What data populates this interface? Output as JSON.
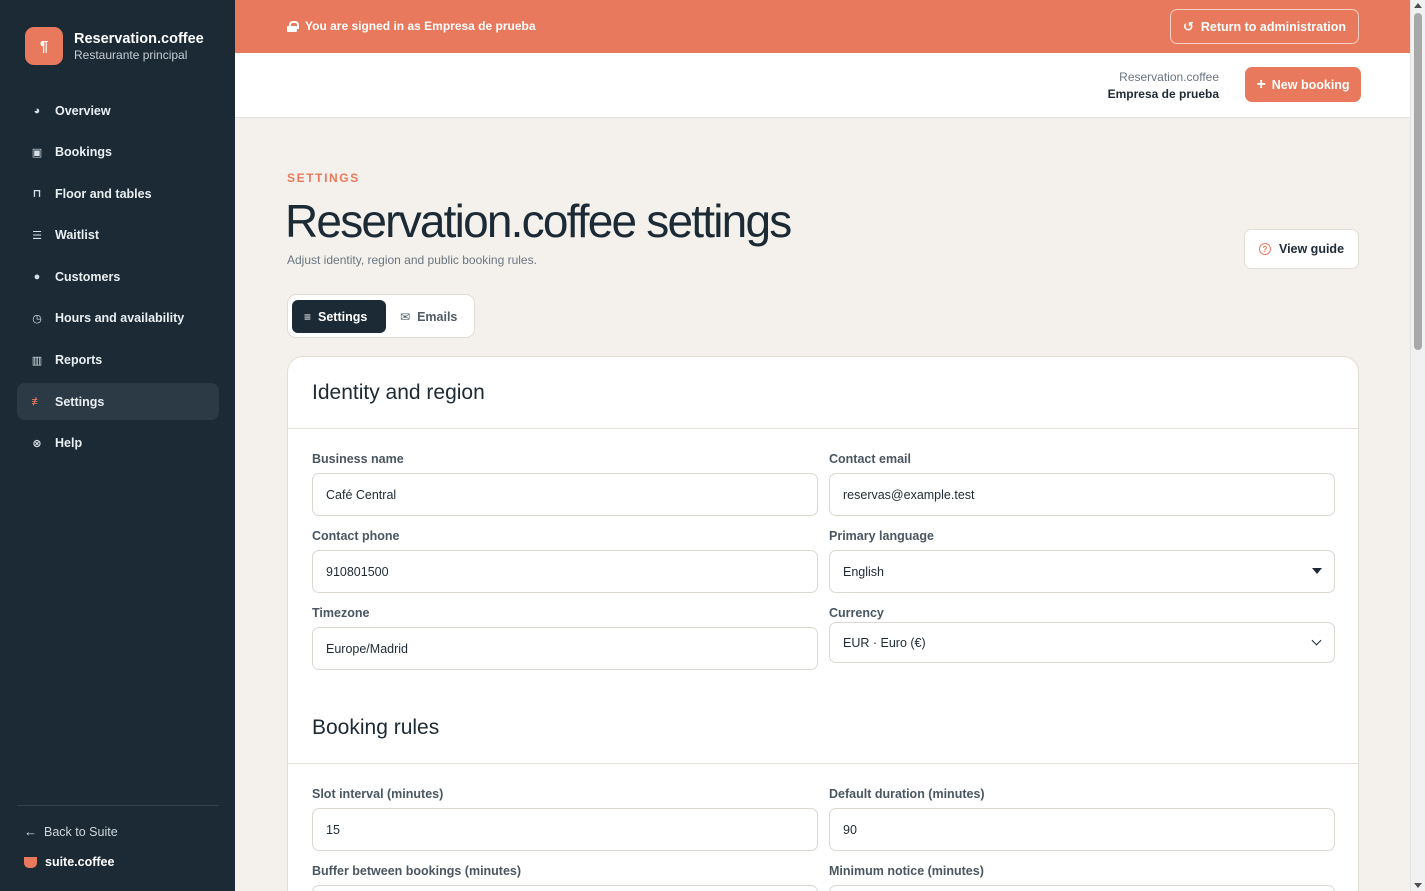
{
  "sidebar": {
    "brand_title": "Reservation.coffee",
    "brand_subtitle": "Restaurante principal",
    "brand_icon": "utensils-icon",
    "items": [
      {
        "label": "Overview",
        "icon": "pie-chart-icon",
        "active": false
      },
      {
        "label": "Bookings",
        "icon": "calendar-icon",
        "active": false
      },
      {
        "label": "Floor and tables",
        "icon": "chair-icon",
        "active": false
      },
      {
        "label": "Waitlist",
        "icon": "list-icon",
        "active": false
      },
      {
        "label": "Customers",
        "icon": "users-icon",
        "active": false
      },
      {
        "label": "Hours and availability",
        "icon": "clock-icon",
        "active": false
      },
      {
        "label": "Reports",
        "icon": "chart-icon",
        "active": false
      },
      {
        "label": "Settings",
        "icon": "sliders-icon",
        "active": true
      },
      {
        "label": "Help",
        "icon": "lifebuoy-icon",
        "active": false
      }
    ],
    "back_label": "Back to Suite",
    "suite_label": "suite.coffee"
  },
  "banner": {
    "message": "You are signed in as Empresa de prueba",
    "return_label": "Return to administration"
  },
  "topbar": {
    "app_name": "Reservation.coffee",
    "company": "Empresa de prueba",
    "new_booking_label": "New booking"
  },
  "page": {
    "eyebrow": "SETTINGS",
    "title": "Reservation.coffee settings",
    "subtitle": "Adjust identity, region and public booking rules.",
    "guide_label": "View guide"
  },
  "tabs": [
    {
      "label": "Settings",
      "active": true
    },
    {
      "label": "Emails",
      "active": false
    }
  ],
  "identity": {
    "title": "Identity and region",
    "business_name": {
      "label": "Business name",
      "value": "Café Central"
    },
    "contact_email": {
      "label": "Contact email",
      "value": "reservas@example.test"
    },
    "contact_phone": {
      "label": "Contact phone",
      "value": "910801500"
    },
    "primary_language": {
      "label": "Primary language",
      "value": "English"
    },
    "timezone": {
      "label": "Timezone",
      "value": "Europe/Madrid"
    },
    "currency": {
      "label": "Currency",
      "value": "EUR · Euro (€)"
    }
  },
  "booking_rules": {
    "title": "Booking rules",
    "slot_interval": {
      "label": "Slot interval (minutes)",
      "value": "15"
    },
    "default_duration": {
      "label": "Default duration (minutes)",
      "value": "90"
    },
    "buffer": {
      "label": "Buffer between bookings (minutes)",
      "value": ""
    },
    "minimum_notice": {
      "label": "Minimum notice (minutes)",
      "value": ""
    }
  },
  "colors": {
    "accent": "#e8795c",
    "sidebar_bg": "#1b2a35",
    "page_bg": "#f4f1ec"
  }
}
